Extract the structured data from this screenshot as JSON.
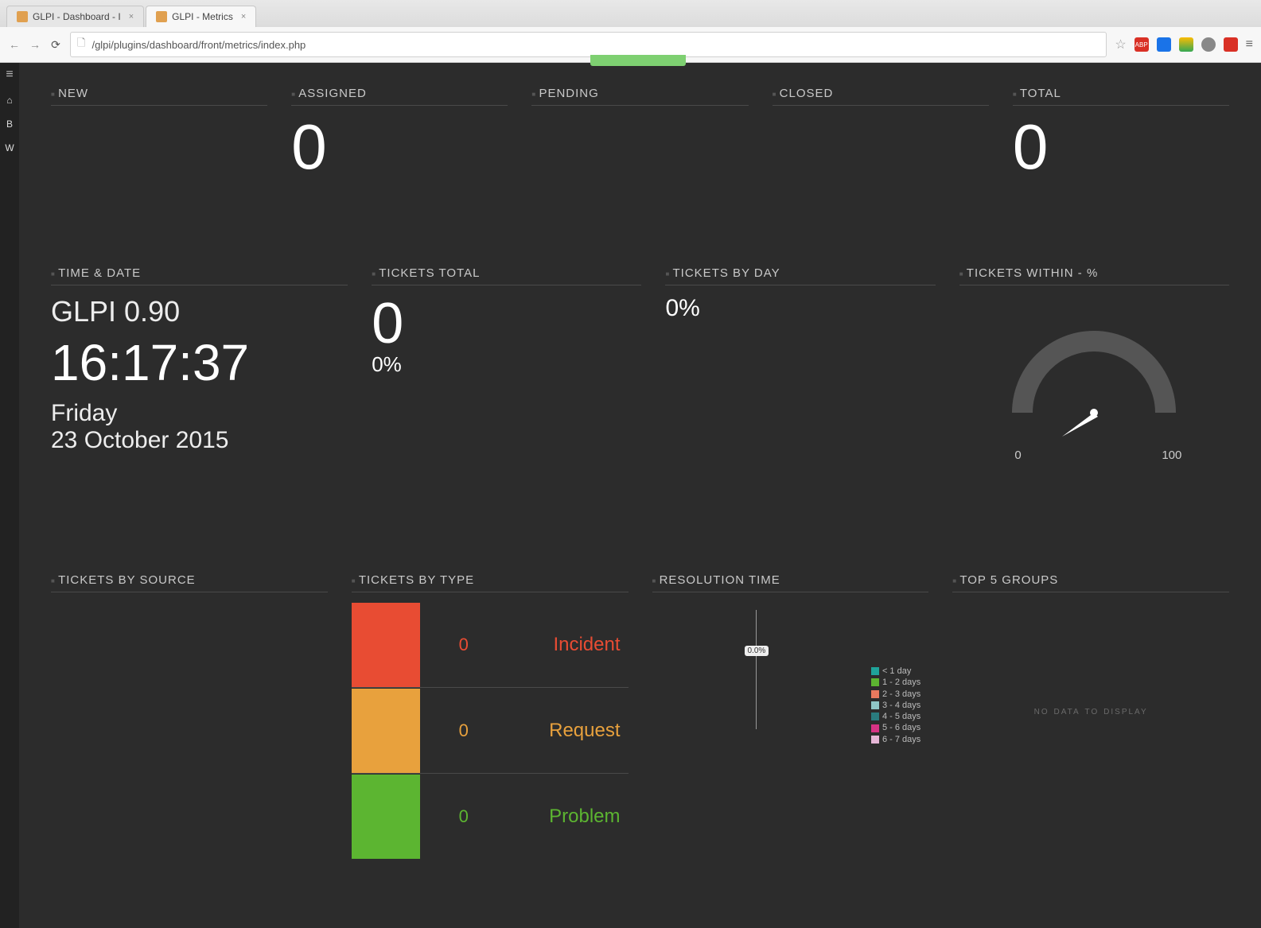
{
  "browser": {
    "tabs": [
      {
        "title": "GLPI - Dashboard - I",
        "active": false
      },
      {
        "title": "GLPI - Metrics",
        "active": true
      }
    ],
    "url": "/glpi/plugins/dashboard/front/metrics/index.php"
  },
  "sidebar": {
    "items": [
      "≡",
      "⌂",
      "B",
      "W"
    ]
  },
  "status_row": {
    "new": {
      "label": "NEW",
      "value": ""
    },
    "assigned": {
      "label": "ASSIGNED",
      "value": "0"
    },
    "pending": {
      "label": "PENDING",
      "value": ""
    },
    "closed": {
      "label": "CLOSED",
      "value": ""
    },
    "total": {
      "label": "TOTAL",
      "value": "0"
    }
  },
  "time_date": {
    "label": "TIME & DATE",
    "version": "GLPI 0.90",
    "clock": "16:17:37",
    "day": "Friday",
    "date": "23 October 2015"
  },
  "tickets_total": {
    "label": "TICKETS TOTAL",
    "value": "0",
    "pct": "0%"
  },
  "tickets_by_day": {
    "label": "TICKETS BY DAY",
    "pct": "0%"
  },
  "tickets_within": {
    "label": "TICKETS WITHIN - %",
    "min": "0",
    "max": "100",
    "value": 0
  },
  "tickets_by_source": {
    "label": "TICKETS BY SOURCE"
  },
  "tickets_by_type": {
    "label": "TICKETS BY TYPE",
    "rows": [
      {
        "count": "0",
        "name": "Incident",
        "color": "#e84c33"
      },
      {
        "count": "0",
        "name": "Request",
        "color": "#e8a13d"
      },
      {
        "count": "0",
        "name": "Problem",
        "color": "#5cb531"
      }
    ]
  },
  "resolution_time": {
    "label": "RESOLUTION TIME",
    "badge": "0.0%",
    "legend": [
      {
        "label": "< 1 day",
        "color": "#1fa39a"
      },
      {
        "label": "1 - 2 days",
        "color": "#5cb531"
      },
      {
        "label": "2 - 3 days",
        "color": "#e8795e"
      },
      {
        "label": "3 - 4 days",
        "color": "#8fc6c6"
      },
      {
        "label": "4 - 5 days",
        "color": "#2a7b7e"
      },
      {
        "label": "5 - 6 days",
        "color": "#d63384"
      },
      {
        "label": "6 - 7 days",
        "color": "#e6b6d6"
      }
    ]
  },
  "top5_groups": {
    "label": "TOP 5 GROUPS",
    "empty": "no data to display"
  },
  "chart_data": [
    {
      "type": "gauge",
      "title": "TICKETS WITHIN - %",
      "value": 0,
      "min": 0,
      "max": 100
    },
    {
      "type": "bar",
      "title": "TICKETS BY TYPE",
      "categories": [
        "Incident",
        "Request",
        "Problem"
      ],
      "values": [
        0,
        0,
        0
      ],
      "colors": [
        "#e84c33",
        "#e8a13d",
        "#5cb531"
      ]
    }
  ]
}
